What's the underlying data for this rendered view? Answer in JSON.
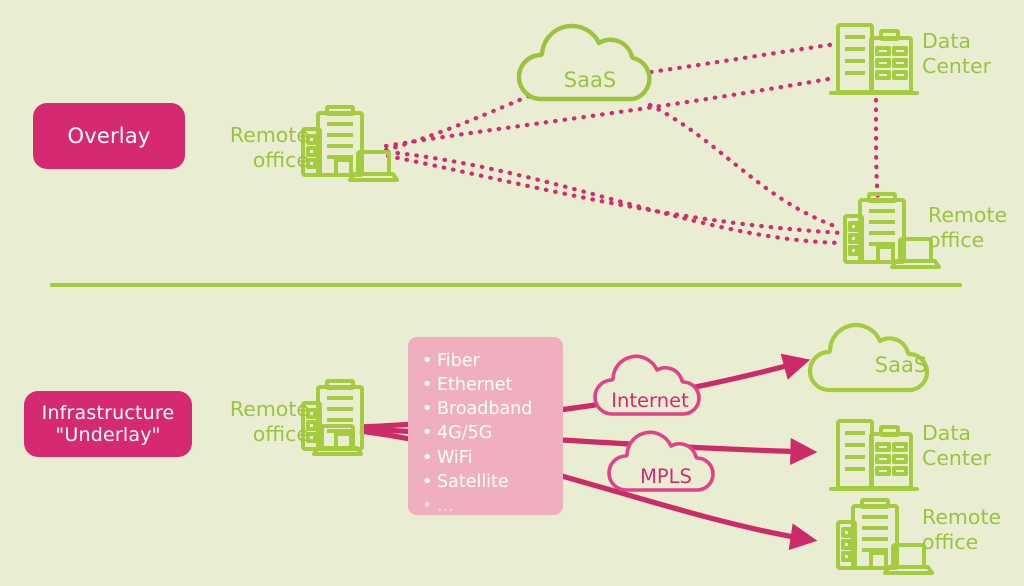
{
  "diagram": {
    "background_color": "#e9eed2",
    "accent_pink": "#d52a72",
    "accent_green": "#9cc33e",
    "transport_box_color": "#efafbf"
  },
  "sections": {
    "overlay": {
      "badge_label": "Overlay",
      "nodes": {
        "remote_office_left": "Remote\noffice",
        "saas": "SaaS",
        "data_center": "Data\nCenter",
        "remote_office_right": "Remote\noffice"
      }
    },
    "underlay": {
      "badge_line1": "Infrastructure",
      "badge_line2": "\"Underlay\"",
      "nodes": {
        "remote_office_left": "Remote\noffice",
        "saas": "SaaS",
        "data_center": "Data\nCenter",
        "remote_office_right": "Remote\noffice"
      },
      "transports": [
        "Fiber",
        "Ethernet",
        "Broadband",
        "4G/5G",
        "WiFi",
        "Satellite",
        "..."
      ],
      "networks": {
        "internet": "Internet",
        "mpls": "MPLS"
      }
    }
  }
}
